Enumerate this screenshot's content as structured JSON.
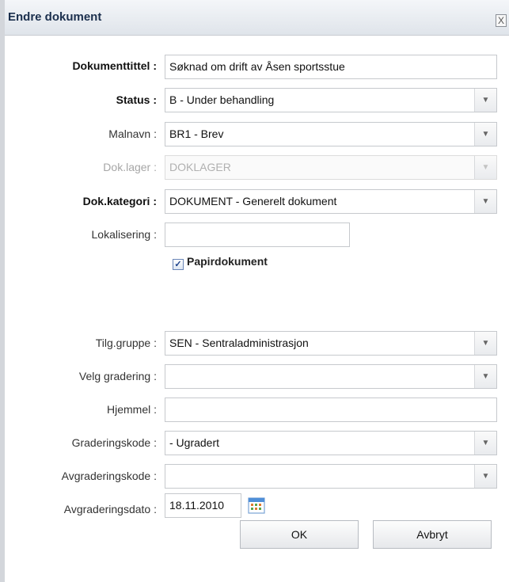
{
  "dialog": {
    "title": "Endre dokument",
    "close_glyph": "X"
  },
  "form": {
    "dokumenttittel": {
      "label": "Dokumenttittel :",
      "value": "Søknad om drift av Åsen sportsstue"
    },
    "status": {
      "label": "Status :",
      "value": "B - Under behandling"
    },
    "malnavn": {
      "label": "Malnavn :",
      "value": "BR1 - Brev"
    },
    "doklager": {
      "label": "Dok.lager :",
      "value": "DOKLAGER"
    },
    "dokkategori": {
      "label": "Dok.kategori :",
      "value": "DOKUMENT - Generelt dokument"
    },
    "lokalisering": {
      "label": "Lokalisering :",
      "value": ""
    },
    "papirdokument": {
      "label": "Papirdokument",
      "checked": true,
      "check_glyph": "✓"
    },
    "tilggruppe": {
      "label": "Tilg.gruppe :",
      "value": "SEN - Sentraladministrasjon"
    },
    "velg_gradering": {
      "label": "Velg gradering :",
      "value": ""
    },
    "hjemmel": {
      "label": "Hjemmel :",
      "value": ""
    },
    "graderingskode": {
      "label": "Graderingskode :",
      "value": "- Ugradert"
    },
    "avgraderingskode": {
      "label": "Avgraderingskode :",
      "value": ""
    },
    "avgraderingsdato": {
      "label": "Avgraderingsdato :",
      "value": "18.11.2010"
    }
  },
  "buttons": {
    "ok": "OK",
    "cancel": "Avbryt"
  },
  "icons": {
    "dropdown_arrow": "▼",
    "calendar": "calendar-icon"
  }
}
